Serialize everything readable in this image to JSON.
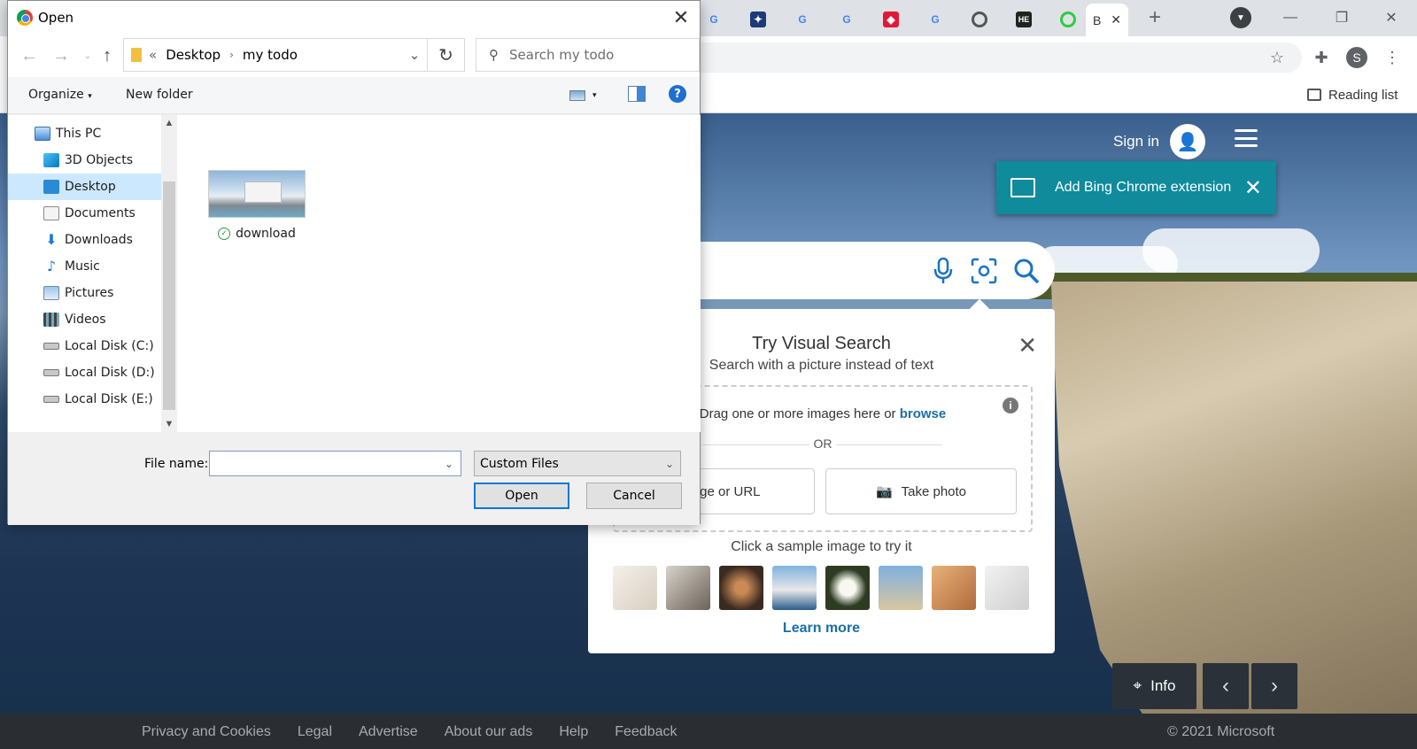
{
  "browser": {
    "active_tab_label": "B",
    "reading_list_label": "Reading list",
    "profile_initial": "S"
  },
  "bing": {
    "sign_in_label": "Sign in",
    "extension_banner_text": "Add Bing Chrome extension",
    "visual_search": {
      "title": "Try Visual Search",
      "subtitle": "Search with a picture instead of text",
      "drag_text": "Drag one or more images here or",
      "browse_label": "browse",
      "or_label": "OR",
      "paste_button_label": "e image or URL",
      "take_photo_label": "Take photo",
      "sample_label": "Click a sample image to try it",
      "learn_more_label": "Learn more"
    },
    "info_label": "Info",
    "footer": {
      "links": [
        "Privacy and Cookies",
        "Legal",
        "Advertise",
        "About our ads",
        "Help",
        "Feedback"
      ],
      "copyright": "© 2021 Microsoft"
    }
  },
  "dialog": {
    "title": "Open",
    "breadcrumb": [
      "Desktop",
      "my todo"
    ],
    "breadcrumb_overflow": "«",
    "search_placeholder": "Search my todo",
    "organize_label": "Organize",
    "new_folder_label": "New folder",
    "nav_items": [
      {
        "label": "This PC",
        "icon": "computer-icon"
      },
      {
        "label": "3D Objects",
        "icon": "3d-objects-icon"
      },
      {
        "label": "Desktop",
        "icon": "desktop-icon",
        "selected": true
      },
      {
        "label": "Documents",
        "icon": "documents-icon"
      },
      {
        "label": "Downloads",
        "icon": "downloads-icon"
      },
      {
        "label": "Music",
        "icon": "music-icon"
      },
      {
        "label": "Pictures",
        "icon": "pictures-icon"
      },
      {
        "label": "Videos",
        "icon": "videos-icon"
      },
      {
        "label": "Local Disk (C:)",
        "icon": "drive-icon"
      },
      {
        "label": "Local Disk (D:)",
        "icon": "drive-icon"
      },
      {
        "label": "Local Disk (E:)",
        "icon": "drive-icon"
      }
    ],
    "files": [
      {
        "name": "download"
      }
    ],
    "file_name_label": "File name:",
    "file_name_value": "",
    "file_type_value": "Custom Files",
    "open_button_label": "Open",
    "cancel_button_label": "Cancel"
  }
}
